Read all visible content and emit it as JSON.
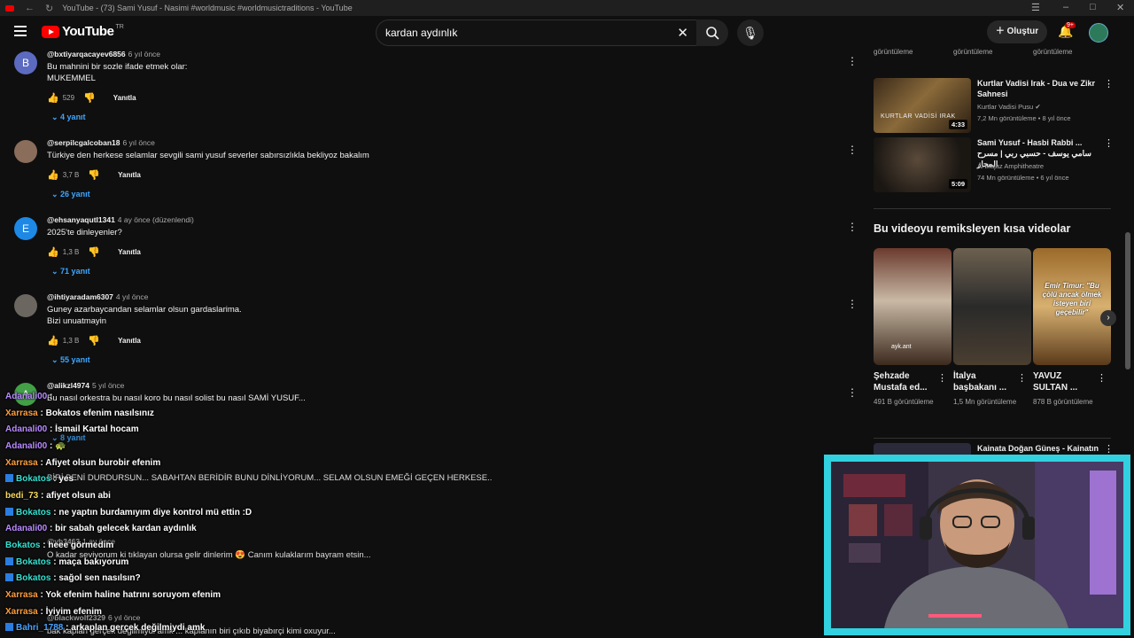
{
  "window": {
    "title": "YouTube - (73) Sami Yusuf - Nasimi #worldmusic #worldmusictraditions - YouTube"
  },
  "header": {
    "logo_text": "YouTube",
    "logo_country": "TR",
    "search_value": "kardan aydınlık",
    "create_label": "Oluştur",
    "notif_badge": "9+"
  },
  "comments": [
    {
      "handle": "@bxtiyarqacayev6856",
      "when": "6 yıl önce",
      "lines": [
        "Bu mahnini bir sozle ifade etmek olar:",
        "MUKEMMEL"
      ],
      "likes": "529",
      "reply_label": "Yanıtla",
      "replies": "4 yanıt",
      "avatar_letter": "B",
      "avatar_color": "#5c6bc0"
    },
    {
      "handle": "@serpilcgalcoban18",
      "when": "6 yıl önce",
      "lines": [
        "Türkiye den herkese selamlar sevgili sami yusuf severler sabırsızlıkla bekliyoz bakalım"
      ],
      "likes": "3,7 B",
      "reply_label": "Yanıtla",
      "replies": "26 yanıt",
      "avatar_letter": "",
      "avatar_color": "#8a6d5a"
    },
    {
      "handle": "@ehsanyaqutl1341",
      "when": "4 ay önce (düzenlendi)",
      "lines": [
        "2025'te dinleyenler?"
      ],
      "likes": "1,3 B",
      "reply_label": "Yanıtla",
      "replies": "71 yanıt",
      "avatar_letter": "E",
      "avatar_color": "#1e88e5"
    },
    {
      "handle": "@ihtiyaradam6307",
      "when": "4 yıl önce",
      "lines": [
        "Guney azarbaycandan selamlar olsun gardaslarima.",
        "Bizi unuatmayin"
      ],
      "likes": "1,3 B",
      "reply_label": "Yanıtla",
      "replies": "55 yanıt",
      "avatar_letter": "",
      "avatar_color": "#6b6660"
    },
    {
      "handle": "@alikzl4974",
      "when": "5 yıl önce",
      "lines": [
        "Bu nasıl orkestra bu nasıl koro bu nasıl solist bu nasıl SAMİ YUSUF..."
      ],
      "likes": "",
      "reply_label": "",
      "replies": "8 yanıt",
      "avatar_letter": "A",
      "avatar_color": "#43a047"
    }
  ],
  "hidden_comments": {
    "line_a": "BİRİ BENİ DURDURSUN... SABAHTAN BERİDİR BUNU DİNLİYORUM... SELAM OLSUN EMEĞİ GEÇEN HERKESE..",
    "line_b": "O kadar seviyorum ki tıklayan olursa gelir dinlerim 😍 Canım kulaklarım bayram etsin...",
    "line_c": "bak kaplan gerçek değilmiydi amk ... kaplanın biri çıkıb biyabırçi kimi oxuyur...",
    "handle_c": "@yb3463",
    "when_c": "1 ay önce",
    "handle_d": "@blackwolf2329",
    "when_d": "6 yıl önce"
  },
  "chat": [
    {
      "user": "Adanali00",
      "color": "#b98aff",
      "msg": "",
      "twitch": false
    },
    {
      "user": "Xarrasa",
      "color": "#ff9e3d",
      "msg": "Bokatos efenim nasılsınız",
      "twitch": false
    },
    {
      "user": "Adanali00",
      "color": "#b98aff",
      "msg": "İsmail Kartal hocam",
      "twitch": false
    },
    {
      "user": "Adanali00",
      "color": "#b98aff",
      "msg": "🐢",
      "twitch": false
    },
    {
      "user": "Xarrasa",
      "color": "#ff9e3d",
      "msg": "Afiyet olsun burobir efenim",
      "twitch": false
    },
    {
      "user": "Bokatos",
      "color": "#35e0d1",
      "msg": "yes",
      "twitch": true
    },
    {
      "user": "bedi_73",
      "color": "#f6d860",
      "msg": "afiyet olsun abi",
      "twitch": false
    },
    {
      "user": "Bokatos",
      "color": "#35e0d1",
      "msg": "ne yaptın burdamıyım diye kontrol mü ettin :D",
      "twitch": true
    },
    {
      "user": "Adanali00",
      "color": "#b98aff",
      "msg": "bir sabah gelecek kardan aydınlık",
      "twitch": false
    },
    {
      "user": "Bokatos",
      "color": "#35e0d1",
      "msg": "heee görmedim",
      "twitch": false
    },
    {
      "user": "Bokatos",
      "color": "#35e0d1",
      "msg": "maça bakıyorum",
      "twitch": true
    },
    {
      "user": "Bokatos",
      "color": "#35e0d1",
      "msg": "sağol sen nasılsın?",
      "twitch": true
    },
    {
      "user": "Xarrasa",
      "color": "#ff9e3d",
      "msg": "Yok efenim haline hatrını soruyom efenim",
      "twitch": false
    },
    {
      "user": "Xarrasa",
      "color": "#ff9e3d",
      "msg": "İyiyim efenim",
      "twitch": false
    },
    {
      "user": "Bahri_1788",
      "color": "#4aa3ff",
      "msg": "arkaplan gerçek değilmiydi amk",
      "twitch": true
    }
  ],
  "sidebar": {
    "views_label": "görüntüleme",
    "recs": [
      {
        "title": "Kurtlar Vadisi Irak - Dua ve Zikr Sahnesi",
        "channel": "Kurtlar Vadisi Pusu",
        "stats": "7,2 Mn görüntüleme • 8 yıl önce",
        "duration": "4:33",
        "thumb_caption": "KURTLAR VADİSİ IRAK"
      },
      {
        "title": "Sami Yusuf - Hasbi Rabbi ... سامي يوسف - حسبي ربي | مسرح المجاز",
        "channel": "Al Majaz Amphitheatre",
        "stats": "74 Mn görüntüleme • 6 yıl önce",
        "duration": "5:09",
        "thumb_caption": ""
      }
    ],
    "shorts_heading": "Bu videoyu remiksleyen kısa videolar",
    "shorts": [
      {
        "title": "Şehzade Mustafa ed...",
        "views": "491 B görüntüleme",
        "overlay": "ayk.ant"
      },
      {
        "title": "İtalya başbakanı ...",
        "views": "1,5 Mn görüntüleme",
        "overlay": ""
      },
      {
        "title": "YAVUZ SULTAN ...",
        "views": "878 B görüntüleme",
        "overlay": "Emir Timur: \"Bu çölü ancak ölmek isteyen biri geçebilir\""
      }
    ],
    "next_rec": {
      "title": "Kainata Doğan Güneş - Kainatın"
    }
  },
  "colors": {
    "background": "#0f0f0f",
    "link_blue": "#3ea6ff",
    "webcam_border": "#31d1df"
  }
}
